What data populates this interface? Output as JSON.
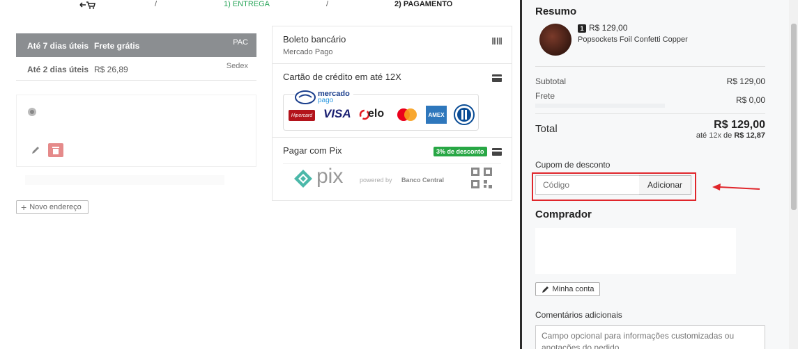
{
  "breadcrumb": {
    "separator": "/",
    "step1": "1) ENTREGA",
    "step2": "2) PAGAMENTO"
  },
  "shipping": {
    "options": [
      {
        "days": "Até 7 dias úteis",
        "price": "Frete grátis",
        "carrier": "PAC",
        "selected": true
      },
      {
        "days": "Até 2 dias úteis",
        "price": "R$ 26,89",
        "carrier": "Sedex",
        "selected": false
      }
    ]
  },
  "address": {
    "new_address_label": "Novo endereço"
  },
  "payment": {
    "boleto": {
      "title": "Boleto bancário",
      "subtitle": "Mercado Pago"
    },
    "card": {
      "title": "Cartão de crédito em até 12X",
      "provider_line1": "mercado",
      "provider_line2": "pago",
      "brands": [
        "Hipercard",
        "VISA",
        "elo",
        "Mastercard",
        "AMEX",
        "Diners"
      ]
    },
    "pix": {
      "title": "Pagar com Pix",
      "badge": "3% de desconto",
      "logo_text": "pix",
      "powered_by": "powered by",
      "bank": "Banco Central"
    }
  },
  "summary": {
    "title": "Resumo",
    "item": {
      "qty": "1",
      "price": "R$ 129,00",
      "name": "Popsockets Foil Confetti Copper"
    },
    "subtotal_label": "Subtotal",
    "subtotal_value": "R$ 129,00",
    "frete_label": "Frete",
    "frete_value": "R$ 0,00",
    "total_label": "Total",
    "total_value": "R$ 129,00",
    "installments_prefix": "até",
    "installments_count": "12x",
    "installments_de": "de",
    "installments_value": "R$ 12,87"
  },
  "coupon": {
    "label": "Cupom de desconto",
    "placeholder": "Código",
    "button": "Adicionar"
  },
  "buyer": {
    "title": "Comprador",
    "account_button": "Minha conta"
  },
  "comments": {
    "label": "Comentários adicionais",
    "placeholder": "Campo opcional para informações customizadas ou anotações do pedido"
  },
  "colors": {
    "highlight_red": "#e0262b",
    "accent_green": "#2aa55a",
    "header_gray": "#8b8e91"
  }
}
